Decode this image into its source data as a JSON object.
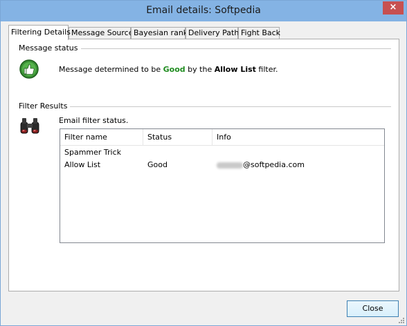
{
  "window": {
    "title": "Email details: Softpedia",
    "close_glyph": "×"
  },
  "tabs": [
    {
      "label": "Filtering Details"
    },
    {
      "label": "Message Source"
    },
    {
      "label": "Bayesian rank"
    },
    {
      "label": "Delivery Path"
    },
    {
      "label": "Fight Back"
    }
  ],
  "message_status": {
    "section_title": "Message status",
    "prefix": "Message determined to be ",
    "verdict": "Good",
    "middle": " by the ",
    "filter_name": "Allow List",
    "suffix": " filter.",
    "icon": "thumbs-up-icon",
    "verdict_color": "#1f8c1f"
  },
  "filter_results": {
    "section_title": "Filter Results",
    "caption": "Email filter status.",
    "icon": "binoculars-icon",
    "columns": [
      "Filter name",
      "Status",
      "Info"
    ],
    "rows": [
      {
        "filter": "Spammer Trick",
        "status": "",
        "info": ""
      },
      {
        "filter": "Allow List",
        "status": "Good",
        "info": "@softpedia.com"
      }
    ]
  },
  "footer": {
    "close_label": "Close"
  },
  "colors": {
    "titlebar": "#84b3e4",
    "window_close": "#c75050",
    "button_border": "#3c7fb1"
  }
}
